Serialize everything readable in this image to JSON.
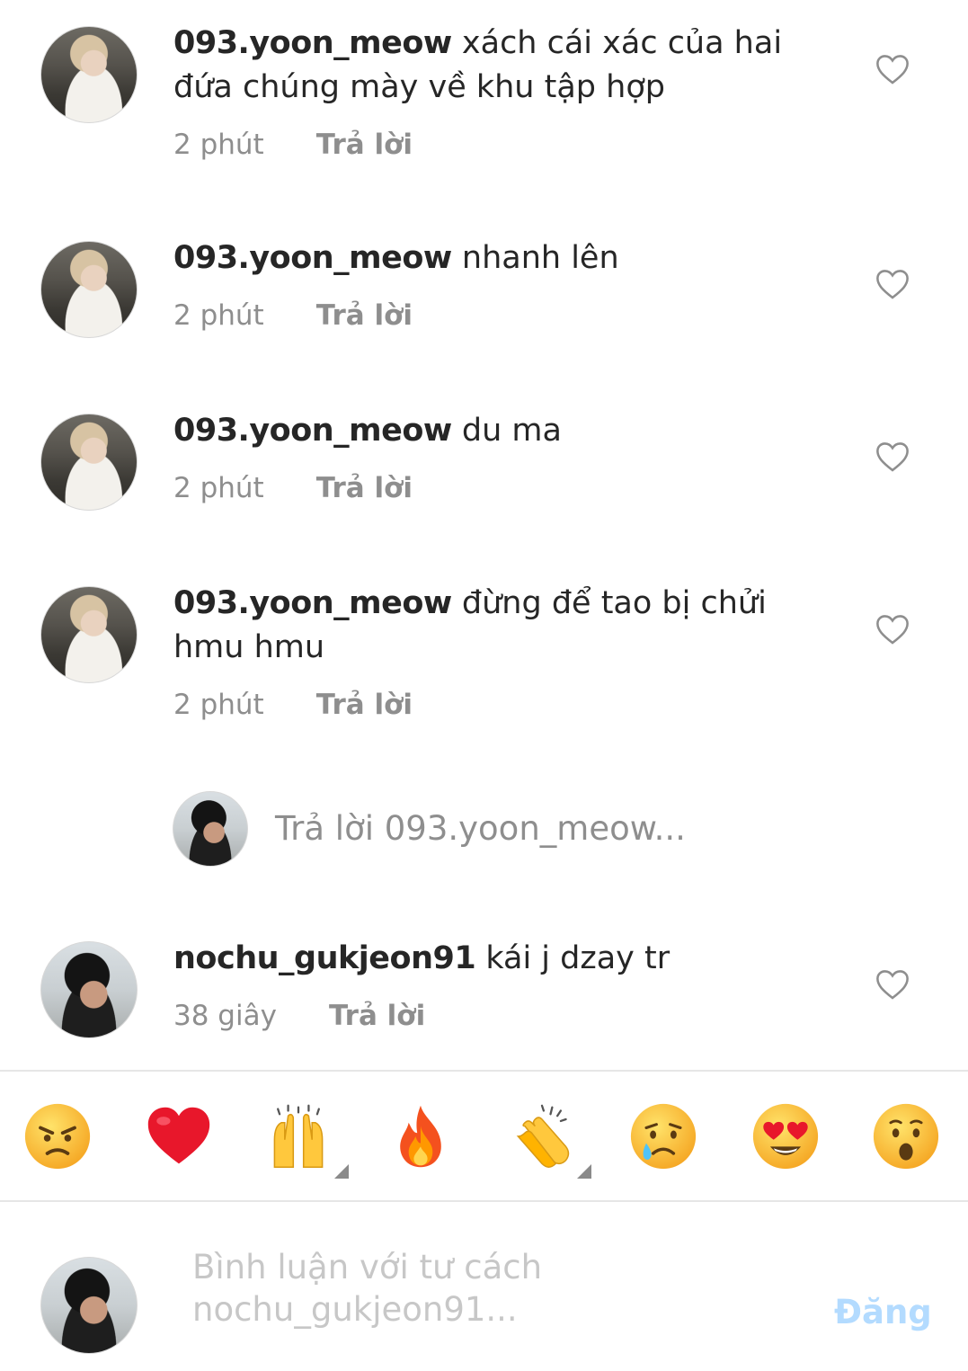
{
  "comments": [
    {
      "username": "093.yoon_meow",
      "text": "xách cái xác của hai đứa chúng mày về khu tập hợp",
      "time": "2 phút",
      "reply_label": "Trả lời"
    },
    {
      "username": "093.yoon_meow",
      "text": "nhanh lên",
      "time": "2 phút",
      "reply_label": "Trả lời"
    },
    {
      "username": "093.yoon_meow",
      "text": "du ma",
      "time": "2 phút",
      "reply_label": "Trả lời"
    },
    {
      "username": "093.yoon_meow",
      "text": "đừng để tao bị chửi hmu hmu",
      "time": "2 phút",
      "reply_label": "Trả lời"
    },
    {
      "username": "nochu_gukjeon91",
      "text": "kái j dzay tr",
      "time": "38 giây",
      "reply_label": "Trả lời"
    }
  ],
  "reply_placeholder": "Trả lời 093.yoon_meow...",
  "emoji_bar": {
    "items": [
      "angry-face",
      "red-heart",
      "raising-hands",
      "fire",
      "clapping-hands",
      "crying-face",
      "heart-eyes-face",
      "surprised-face"
    ]
  },
  "composer": {
    "placeholder_line1": "Bình luận với tư cách",
    "placeholder_line2": "nochu_gukjeon91...",
    "post_label": "Đăng"
  },
  "colors": {
    "text": "#262626",
    "meta": "#8e8e8e",
    "post_disabled": "#b3dbff"
  }
}
